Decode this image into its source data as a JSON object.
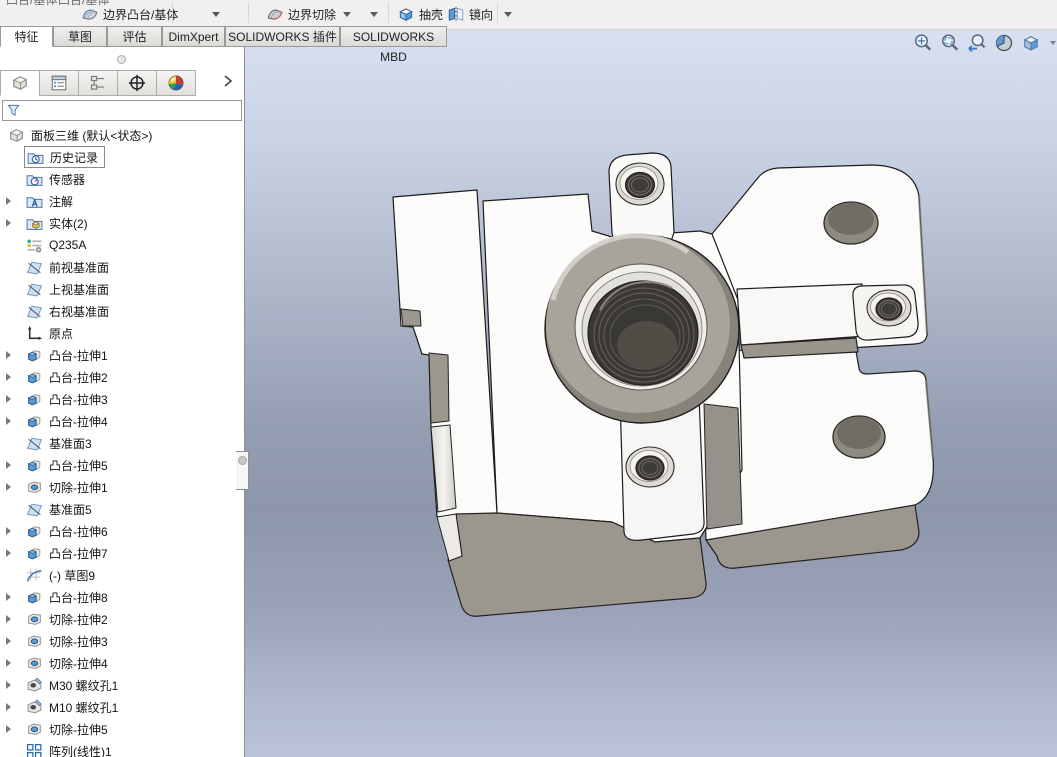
{
  "toolbar": {
    "clipped_row_labels": [
      "凸台/基体",
      "凸台/基体"
    ],
    "buttons": [
      {
        "label": "边界凸台/基体",
        "icon": "boundary-boss-icon"
      },
      {
        "label": "边界切除",
        "icon": "boundary-cut-icon"
      },
      {
        "label": "抽壳",
        "icon": "shell-icon"
      },
      {
        "label": "镜向",
        "icon": "mirror-icon"
      }
    ]
  },
  "ribbon_tabs": [
    {
      "label": "特征",
      "active": true
    },
    {
      "label": "草图",
      "active": false
    },
    {
      "label": "评估",
      "active": false
    },
    {
      "label": "DimXpert",
      "active": false
    },
    {
      "label": "SOLIDWORKS 插件",
      "active": false
    },
    {
      "label": "SOLIDWORKS MBD",
      "active": false
    }
  ],
  "manager_panel": {
    "tabs": [
      {
        "icon": "featuremanager-icon",
        "active": true
      },
      {
        "icon": "propertymanager-icon",
        "active": false
      },
      {
        "icon": "configurationmanager-icon",
        "active": false
      },
      {
        "icon": "dimxpertmanager-icon",
        "active": false
      },
      {
        "icon": "displaymanager-icon",
        "active": false
      }
    ],
    "expand_icon": "chevron-right-icon",
    "filter": {
      "icon": "filter-icon",
      "value": "",
      "placeholder": ""
    },
    "tree": {
      "root": {
        "label": "面板三维 (默认<状态>)",
        "icon": "part"
      },
      "items": [
        {
          "label": "历史记录",
          "icon": "history",
          "selected": true
        },
        {
          "label": "传感器",
          "icon": "sensors"
        },
        {
          "label": "注解",
          "icon": "annotations",
          "expandable": true
        },
        {
          "label": "实体(2)",
          "icon": "bodies",
          "expandable": true
        },
        {
          "label": "Q235A",
          "icon": "material"
        },
        {
          "label": "前视基准面",
          "icon": "plane"
        },
        {
          "label": "上视基准面",
          "icon": "plane"
        },
        {
          "label": "右视基准面",
          "icon": "plane"
        },
        {
          "label": "原点",
          "icon": "origin"
        },
        {
          "label": "凸台-拉伸1",
          "icon": "boss-extrude",
          "expandable": true
        },
        {
          "label": "凸台-拉伸2",
          "icon": "boss-extrude",
          "expandable": true
        },
        {
          "label": "凸台-拉伸3",
          "icon": "boss-extrude",
          "expandable": true
        },
        {
          "label": "凸台-拉伸4",
          "icon": "boss-extrude",
          "expandable": true
        },
        {
          "label": "基准面3",
          "icon": "plane"
        },
        {
          "label": "凸台-拉伸5",
          "icon": "boss-extrude",
          "expandable": true
        },
        {
          "label": "切除-拉伸1",
          "icon": "cut-extrude",
          "expandable": true
        },
        {
          "label": "基准面5",
          "icon": "plane"
        },
        {
          "label": "凸台-拉伸6",
          "icon": "boss-extrude",
          "expandable": true
        },
        {
          "label": "凸台-拉伸7",
          "icon": "boss-extrude",
          "expandable": true
        },
        {
          "label": "(-) 草图9",
          "icon": "sketch"
        },
        {
          "label": "凸台-拉伸8",
          "icon": "boss-extrude",
          "expandable": true
        },
        {
          "label": "切除-拉伸2",
          "icon": "cut-extrude",
          "expandable": true
        },
        {
          "label": "切除-拉伸3",
          "icon": "cut-extrude",
          "expandable": true
        },
        {
          "label": "切除-拉伸4",
          "icon": "cut-extrude",
          "expandable": true
        },
        {
          "label": "M30 螺纹孔1",
          "icon": "tapped-hole",
          "expandable": true
        },
        {
          "label": "M10 螺纹孔1",
          "icon": "tapped-hole",
          "expandable": true
        },
        {
          "label": "切除-拉伸5",
          "icon": "cut-extrude",
          "expandable": true
        },
        {
          "label": "阵列(线性)1",
          "icon": "linear-pattern"
        }
      ]
    }
  },
  "viewport": {
    "heads_up_icons": [
      "zoom-fit-icon",
      "zoom-area-icon",
      "previous-view-icon",
      "section-view-icon",
      "view-orientation-icon",
      "dropdown-caret-icon"
    ],
    "colors": {
      "background_top": "#d8e0f1",
      "background_mid": "#8d96aa",
      "background_bottom": "#bac3d7",
      "part_face": "#fbfbf9",
      "part_shadow": "#9c978e",
      "bore_dark": "#3a3835"
    }
  }
}
